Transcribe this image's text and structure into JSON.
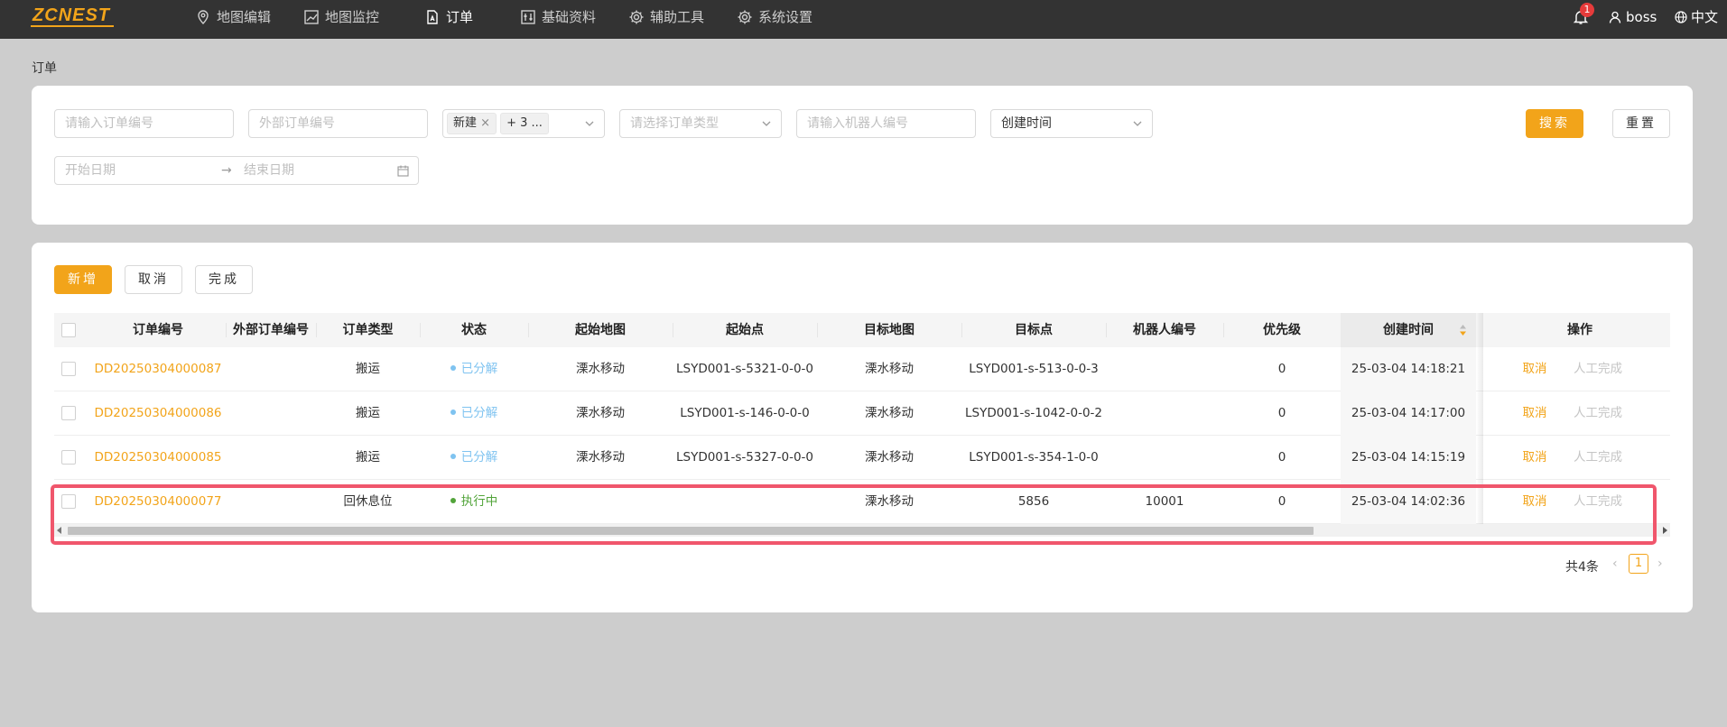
{
  "header": {
    "logo": "ZCNEST",
    "nav": [
      {
        "label": "地图编辑",
        "icon": "map-pin-icon"
      },
      {
        "label": "地图监控",
        "icon": "chart-icon"
      },
      {
        "label": "订单",
        "icon": "document-icon",
        "active": true
      },
      {
        "label": "基础资料",
        "icon": "sliders-icon"
      },
      {
        "label": "辅助工具",
        "icon": "gear-icon"
      },
      {
        "label": "系统设置",
        "icon": "gear-icon"
      }
    ],
    "notification_count": "1",
    "username": "boss",
    "language": "中文"
  },
  "breadcrumb": "订单",
  "filters": {
    "order_no_placeholder": "请输入订单编号",
    "external_no_placeholder": "外部订单编号",
    "status_tag": "新建",
    "status_more": "+ 3 ...",
    "order_type_placeholder": "请选择订单类型",
    "robot_placeholder": "请输入机器人编号",
    "time_field": "创建时间",
    "start_date_placeholder": "开始日期",
    "end_date_placeholder": "结束日期",
    "search_label": "搜索",
    "reset_label": "重置"
  },
  "toolbar": {
    "add_label": "新增",
    "cancel_label": "取消",
    "complete_label": "完成"
  },
  "table": {
    "columns": [
      "订单编号",
      "外部订单编号",
      "订单类型",
      "状态",
      "起始地图",
      "起始点",
      "目标地图",
      "目标点",
      "机器人编号",
      "优先级",
      "创建时间",
      "操作"
    ],
    "rows": [
      {
        "order_no": "DD20250304000087",
        "external_no": "",
        "type": "搬运",
        "status": "已分解",
        "status_color": "#7fc3f0",
        "start_map": "溧水移动",
        "start_point": "LSYD001-s-5321-0-0-0",
        "target_map": "溧水移动",
        "target_point": "LSYD001-s-513-0-0-3",
        "robot": "",
        "priority": "0",
        "created": "25-03-04 14:18:21",
        "action_cancel": "取消",
        "action_complete": "人工完成"
      },
      {
        "order_no": "DD20250304000086",
        "external_no": "",
        "type": "搬运",
        "status": "已分解",
        "status_color": "#7fc3f0",
        "start_map": "溧水移动",
        "start_point": "LSYD001-s-146-0-0-0",
        "target_map": "溧水移动",
        "target_point": "LSYD001-s-1042-0-0-2",
        "robot": "",
        "priority": "0",
        "created": "25-03-04 14:17:00",
        "action_cancel": "取消",
        "action_complete": "人工完成"
      },
      {
        "order_no": "DD20250304000085",
        "external_no": "",
        "type": "搬运",
        "status": "已分解",
        "status_color": "#7fc3f0",
        "start_map": "溧水移动",
        "start_point": "LSYD001-s-5327-0-0-0",
        "target_map": "溧水移动",
        "target_point": "LSYD001-s-354-1-0-0",
        "robot": "",
        "priority": "0",
        "created": "25-03-04 14:15:19",
        "action_cancel": "取消",
        "action_complete": "人工完成"
      },
      {
        "order_no": "DD20250304000077",
        "external_no": "",
        "type": "回休息位",
        "status": "执行中",
        "status_color": "#52a43a",
        "start_map": "",
        "start_point": "",
        "target_map": "溧水移动",
        "target_point": "5856",
        "robot": "10001",
        "priority": "0",
        "created": "25-03-04 14:02:36",
        "action_cancel": "取消",
        "action_complete": "人工完成"
      }
    ]
  },
  "pagination": {
    "total": "共4条",
    "current_page": "1"
  },
  "colors": {
    "accent": "#f2a41a",
    "header_bg": "#333333",
    "highlight": "#f0566c"
  }
}
